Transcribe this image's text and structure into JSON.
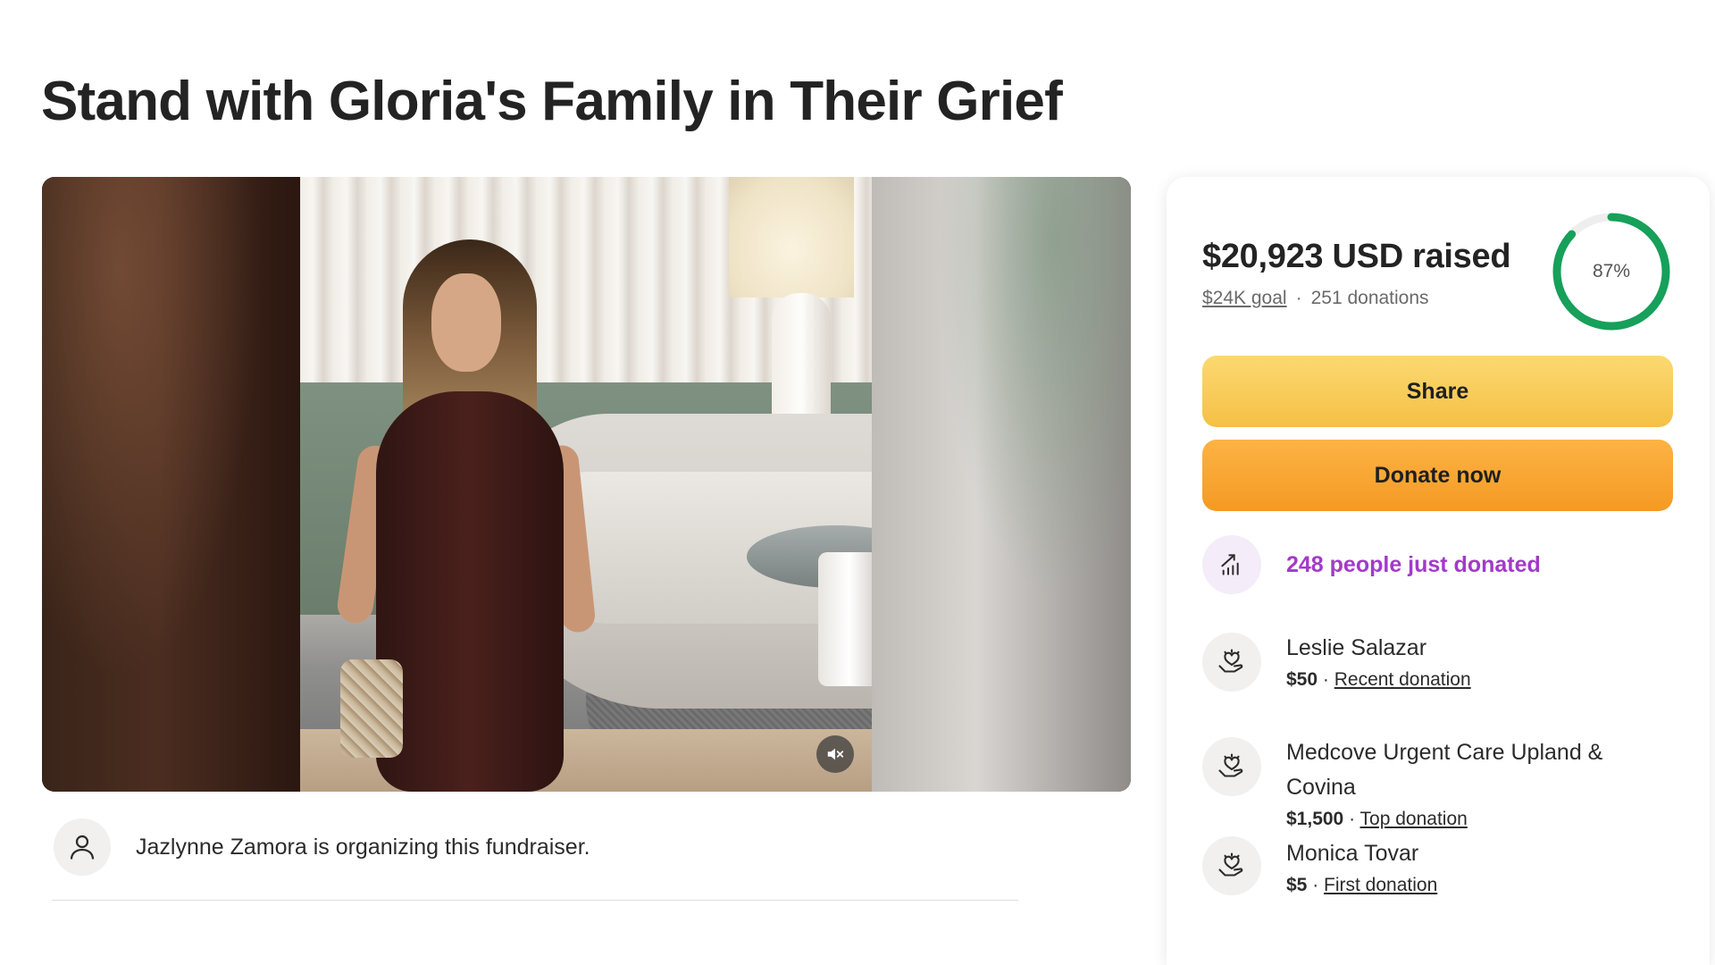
{
  "page": {
    "title": "Stand with Gloria's Family in Their Grief"
  },
  "media": {
    "mute_icon": "speaker-muted-icon"
  },
  "organizer": {
    "text": "Jazlynne Zamora is organizing this fundraiser.",
    "icon": "person-icon"
  },
  "donation_card": {
    "raised": "$20,923 USD raised",
    "goal": "$24K goal",
    "separator": "·",
    "donations": "251 donations",
    "progress_percent": 87,
    "progress_label": "87%",
    "progress_color": "#16a05a",
    "progress_track_color": "#eeeeee",
    "share_label": "Share",
    "donate_label": "Donate now",
    "trend_text": "248 people just donated",
    "trend_icon": "trending-up-icon",
    "donors": [
      {
        "name": "Leslie Salazar",
        "amount": "$50",
        "sep": " · ",
        "kind": "Recent donation",
        "icon": "heart-hand-icon"
      },
      {
        "name": "Medcove Urgent Care Upland & Covina",
        "amount": "$1,500",
        "sep": " · ",
        "kind": "Top donation",
        "icon": "heart-hand-icon"
      },
      {
        "name": "Monica Tovar",
        "amount": "$5",
        "sep": " · ",
        "kind": "First donation",
        "icon": "heart-hand-icon"
      }
    ]
  },
  "colors": {
    "share_button": "#f8cd5a",
    "donate_button": "#f7a632",
    "trend_text": "#a23ac9"
  }
}
